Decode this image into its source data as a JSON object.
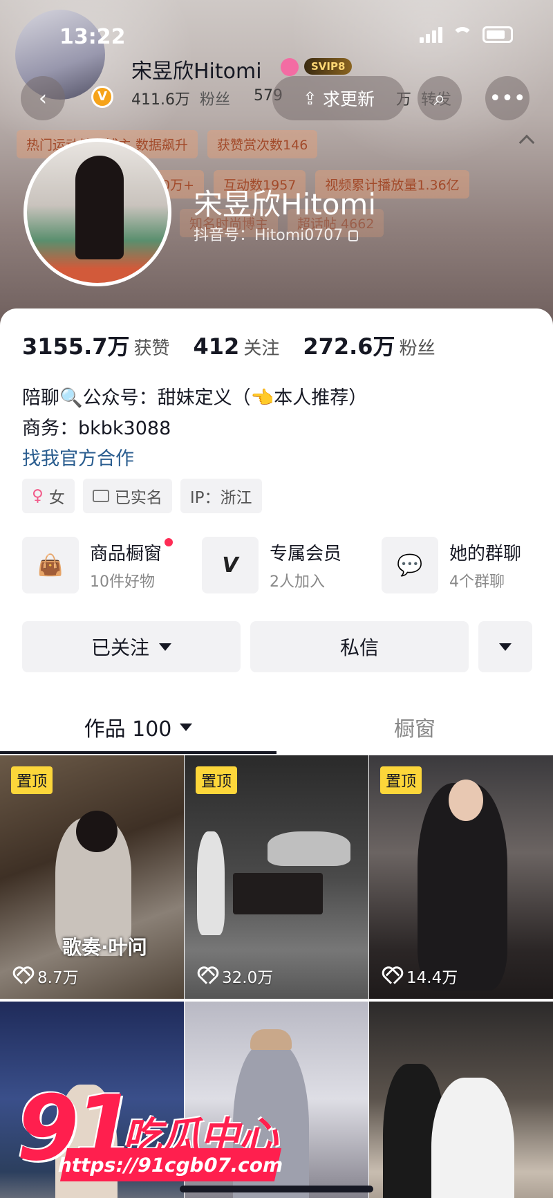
{
  "status_bar": {
    "time": "13:22"
  },
  "header": {
    "mini_name": "宋昱欣Hitomi",
    "svip": "SVIP8",
    "mini_fans_num": "411.6万",
    "mini_fans_label": "粉丝",
    "mini_follow_num": "579",
    "mini_extra": "万",
    "mini_forward": "转发",
    "update_button": "求更新",
    "tags_row1": [
      "热门运动健身博主 数据飙升",
      "获赞赏次数146"
    ],
    "tags_row2": [
      "0万+",
      "互动数1957",
      "视频累计播放量1.36亿"
    ],
    "tags_row3": [
      "知名时尚博主",
      "超话帖 4662"
    ],
    "display_name": "宋昱欣Hitomi",
    "douyin_id": "抖音号：Hitomi0707"
  },
  "stats": [
    {
      "num": "3155.7万",
      "label": "获赞"
    },
    {
      "num": "412",
      "label": "关注"
    },
    {
      "num": "272.6万",
      "label": "粉丝"
    }
  ],
  "bio": {
    "line1": "陪聊🔍公众号：甜妹定义（👈本人推荐）",
    "line2": "商务：bkbk3088",
    "link": "找我官方合作"
  },
  "chips": {
    "gender": "女",
    "verified": "已实名",
    "ip": "IP：浙江"
  },
  "features": [
    {
      "title": "商品橱窗",
      "sub": "10件好物"
    },
    {
      "title": "专属会员",
      "sub": "2人加入"
    },
    {
      "title": "她的群聊",
      "sub": "4个群聊"
    }
  ],
  "actions": {
    "followed": "已关注",
    "message": "私信"
  },
  "tabs": {
    "works": "作品 100",
    "showcase": "橱窗"
  },
  "grid": [
    {
      "pin": "置顶",
      "likes": "8.7万",
      "caption": "歌奏·叶问"
    },
    {
      "pin": "置顶",
      "likes": "32.0万",
      "caption": ""
    },
    {
      "pin": "置顶",
      "likes": "14.4万",
      "caption": ""
    },
    {
      "pin": "",
      "likes": "",
      "caption": ""
    },
    {
      "pin": "",
      "likes": "",
      "caption": ""
    },
    {
      "pin": "",
      "likes": "",
      "caption": ""
    }
  ],
  "watermark": {
    "num": "91",
    "text": "吃瓜中心",
    "url": "https://91cgb07.com"
  },
  "colors": {
    "accent": "#fe2c55",
    "pin": "#fcd63a",
    "link": "#2a5d8f"
  }
}
